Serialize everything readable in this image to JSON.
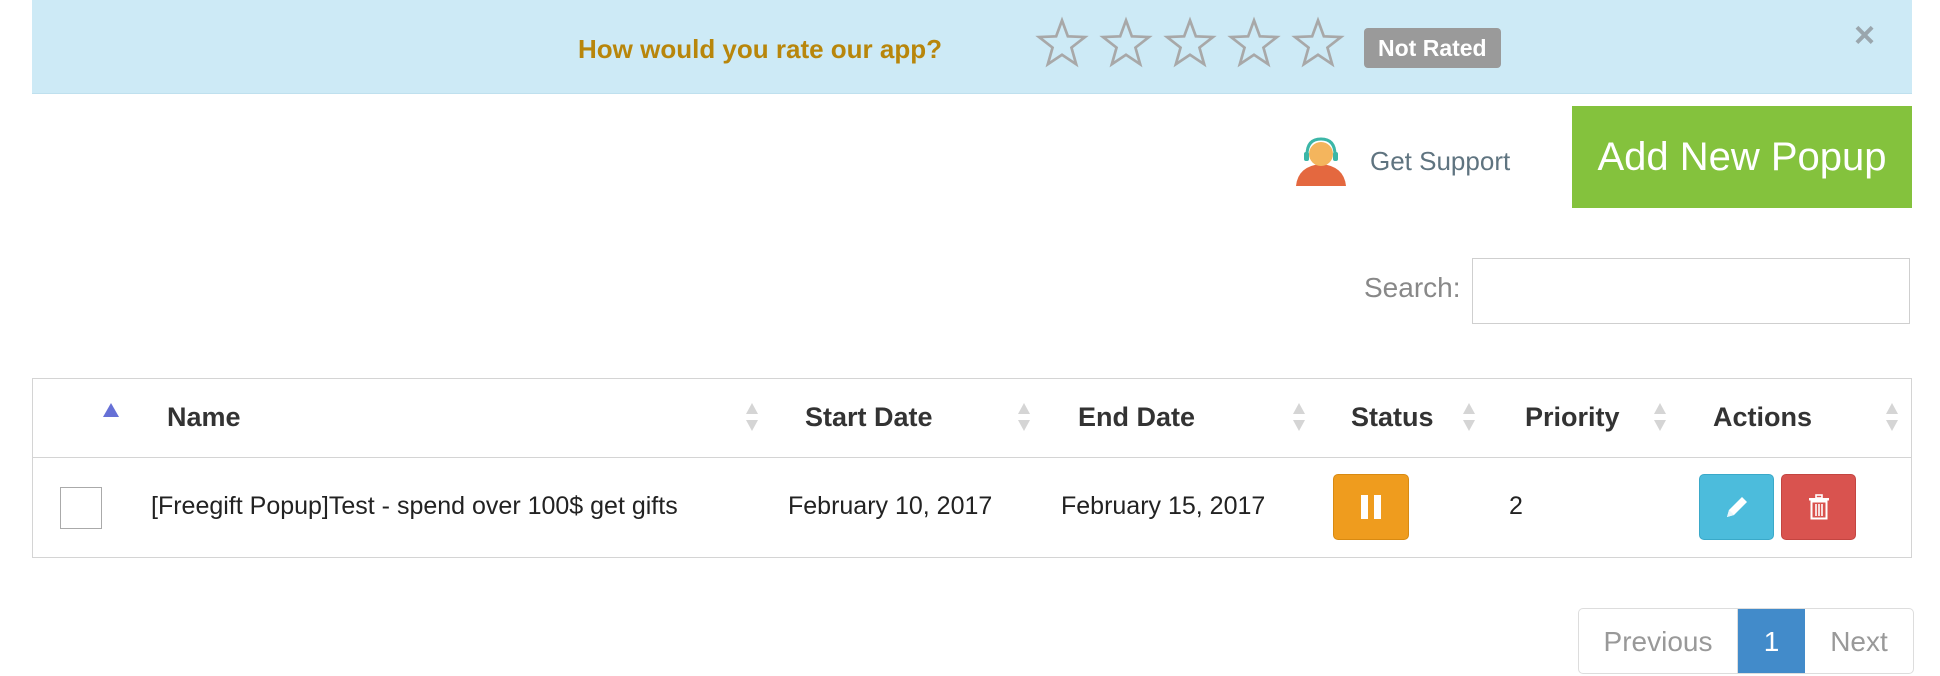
{
  "rating": {
    "question": "How would you rate our app?",
    "stars_total": 5,
    "stars_filled": 0,
    "status_badge": "Not Rated",
    "close_glyph": "×"
  },
  "support": {
    "label": "Get Support",
    "icon": "support-agent-icon"
  },
  "add_button": {
    "label": "Add New Popup",
    "color": "#84c23d"
  },
  "search": {
    "label": "Search:",
    "value": "",
    "placeholder": ""
  },
  "table": {
    "columns": [
      "Name",
      "Start Date",
      "End Date",
      "Status",
      "Priority",
      "Actions"
    ],
    "rows": [
      {
        "name": "[Freegift Popup]Test - spend over 100$ get gifts",
        "start_date": "February 10, 2017",
        "end_date": "February 15, 2017",
        "status_icon": "pause-icon",
        "priority": "2",
        "actions": [
          "edit-icon",
          "trash-icon"
        ]
      }
    ]
  },
  "pagination": {
    "previous": "Previous",
    "current": "1",
    "next": "Next"
  },
  "colors": {
    "rating_bar_bg": "#cdeaf6",
    "question_text": "#b8860b",
    "status_pause": "#ef9c1e",
    "edit": "#4cbcdc",
    "delete": "#d9534f",
    "active_page": "#428bca"
  }
}
